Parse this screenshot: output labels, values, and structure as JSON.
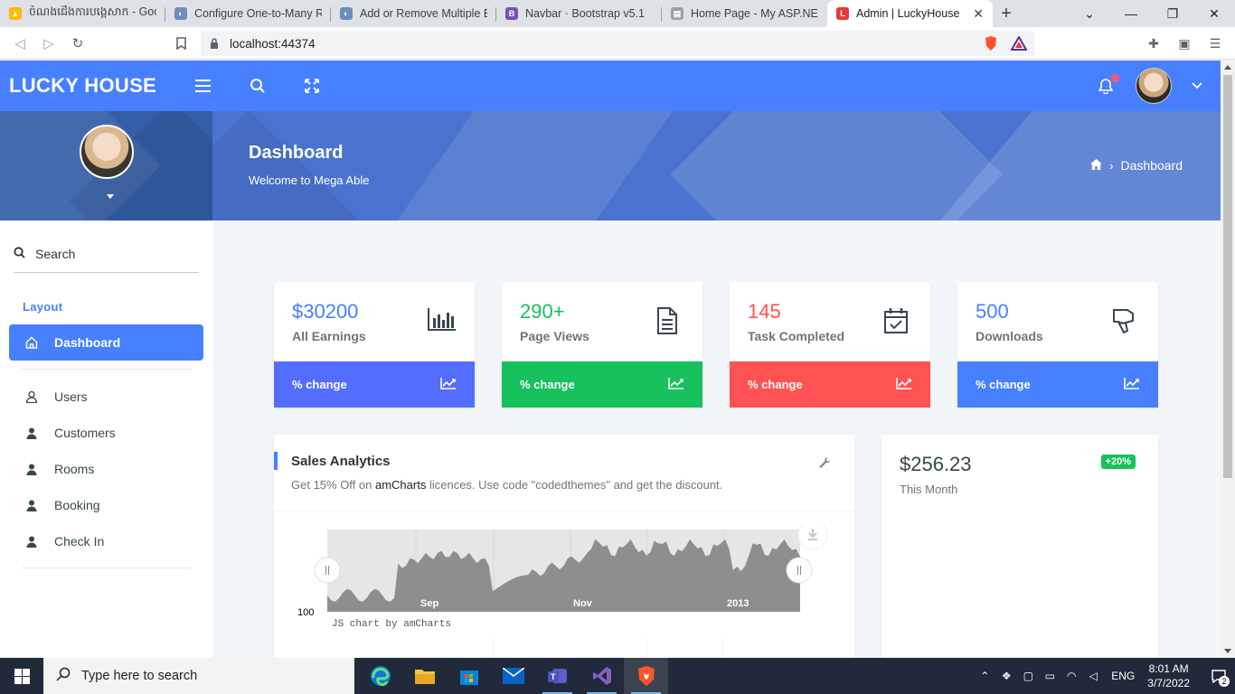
{
  "browser": {
    "tabs": [
      {
        "title": "ចំណងជើងការបង្កេសាក - Goo",
        "fav_color": "#fbbc04",
        "fav": "▲"
      },
      {
        "title": "Configure One-to-Many Re",
        "fav_color": "#6c8ebf",
        "fav": "◐"
      },
      {
        "title": "Add or Remove Multiple En",
        "fav_color": "#6c8ebf",
        "fav": "◐"
      },
      {
        "title": "Navbar · Bootstrap v5.1",
        "fav_color": "#7952b3",
        "fav": "B"
      },
      {
        "title": "Home Page - My ASP.NET A",
        "fav_color": "#9aa0a6",
        "fav": "▤"
      },
      {
        "title": "Admin | LuckyHouse",
        "fav_color": "#e53935",
        "fav": "L",
        "active": true
      }
    ],
    "url": "localhost:44374"
  },
  "app": {
    "brand": "LUCKY HOUSE"
  },
  "sidebar": {
    "search_label": "Search",
    "section": "Layout",
    "active_item": "Dashboard",
    "items": [
      "Users",
      "Customers",
      "Rooms",
      "Booking",
      "Check In"
    ]
  },
  "banner": {
    "title": "Dashboard",
    "subtitle": "Welcome to Mega Able",
    "breadcrumb": "Dashboard"
  },
  "cards": [
    {
      "value": "$30200",
      "label": "All Earnings",
      "footer": "% change",
      "color": "#4680ff",
      "foot_color": "#536dfe",
      "icon": "bar-chart-icon"
    },
    {
      "value": "290+",
      "label": "Page Views",
      "footer": "% change",
      "color": "#17c15b",
      "foot_color": "#17c15b",
      "icon": "file-text-icon"
    },
    {
      "value": "145",
      "label": "Task Completed",
      "footer": "% change",
      "color": "#ff5252",
      "foot_color": "#ff5252",
      "icon": "calendar-check-icon"
    },
    {
      "value": "500",
      "label": "Downloads",
      "footer": "% change",
      "color": "#4680ff",
      "foot_color": "#4680ff",
      "icon": "thumbs-down-icon"
    }
  ],
  "sales": {
    "title": "Sales Analytics",
    "desc_prefix": "Get 15% Off on ",
    "desc_link": "amCharts",
    "desc_suffix": " licences. Use code \"codedthemes\" and get the discount.",
    "axis_value": "100",
    "credit": "JS chart by amCharts",
    "x_labels": [
      "Sep",
      "Nov",
      "2013"
    ]
  },
  "revenue": {
    "amount": "$256.23",
    "period": "This Month",
    "badge": "+20%"
  },
  "taskbar": {
    "search_placeholder": "Type here to search",
    "lang": "ENG",
    "time": "8:01 AM",
    "date": "3/7/2022",
    "notifications": "2"
  }
}
